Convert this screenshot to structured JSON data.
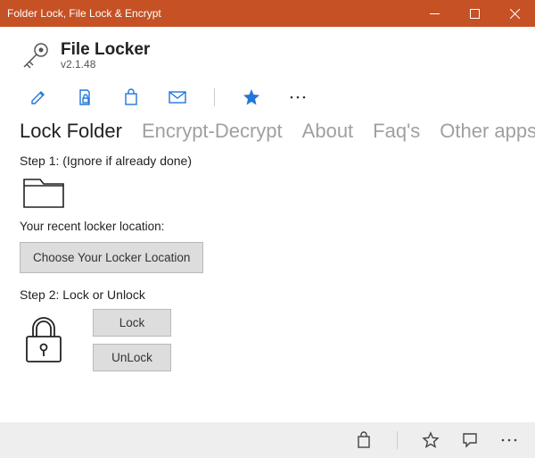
{
  "window": {
    "title": "Folder Lock, File Lock & Encrypt"
  },
  "app": {
    "name": "File Locker",
    "version": "v2.1.48"
  },
  "tabs": {
    "lock_folder": "Lock Folder",
    "encrypt_decrypt": "Encrypt-Decrypt",
    "about": "About",
    "faqs": "Faq's",
    "other_apps": "Other apps"
  },
  "steps": {
    "step1_label": "Step 1: (Ignore if already done)",
    "recent_label": "Your recent locker location:",
    "choose_btn": "Choose Your Locker Location",
    "step2_label": "Step 2: Lock or Unlock",
    "lock_btn": "Lock",
    "unlock_btn": "UnLock"
  }
}
